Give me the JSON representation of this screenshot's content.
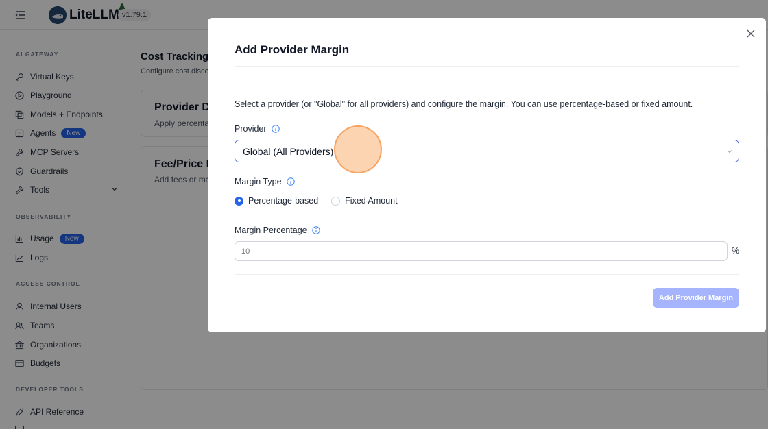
{
  "header": {
    "app_name": "LiteLLM",
    "version": "v1.79.1"
  },
  "sidebar": {
    "sections": [
      {
        "title": "AI GATEWAY"
      },
      {
        "title": "OBSERVABILITY"
      },
      {
        "title": "ACCESS CONTROL"
      },
      {
        "title": "DEVELOPER TOOLS"
      }
    ],
    "items": [
      {
        "label": "Virtual Keys",
        "icon": "key-icon"
      },
      {
        "label": "Playground",
        "icon": "play-icon"
      },
      {
        "label": "Models + Endpoints",
        "icon": "models-icon"
      },
      {
        "label": "Agents",
        "icon": "agent-icon",
        "badge": "New"
      },
      {
        "label": "MCP Servers",
        "icon": "tool-icon"
      },
      {
        "label": "Guardrails",
        "icon": "shield-icon"
      },
      {
        "label": "Tools",
        "icon": "wrench-icon"
      },
      {
        "label": "Usage",
        "icon": "bar-chart-icon",
        "badge": "New"
      },
      {
        "label": "Logs",
        "icon": "line-chart-icon"
      },
      {
        "label": "Internal Users",
        "icon": "user-icon"
      },
      {
        "label": "Teams",
        "icon": "team-icon"
      },
      {
        "label": "Organizations",
        "icon": "bank-icon"
      },
      {
        "label": "Budgets",
        "icon": "credit-card-icon"
      },
      {
        "label": "API Reference",
        "icon": "api-icon"
      }
    ]
  },
  "main": {
    "title": "Cost Tracking S",
    "subtitle": "Configure cost disco",
    "cards": [
      {
        "title": "Provider Di",
        "subtitle": "Apply percenta"
      },
      {
        "title": "Fee/Price M",
        "subtitle": "Add fees or ma"
      }
    ]
  },
  "modal": {
    "title": "Add Provider Margin",
    "description": "Select a provider (or \"Global\" for all providers) and configure the margin. You can use percentage-based or fixed amount.",
    "provider_label": "Provider",
    "provider_value": "Global (All Providers)",
    "margin_type_label": "Margin Type",
    "margin_type_options": [
      "Percentage-based",
      "Fixed Amount"
    ],
    "margin_type_selected": "Percentage-based",
    "margin_percentage_label": "Margin Percentage",
    "margin_percentage_placeholder": "10",
    "margin_percentage_suffix": "%",
    "submit_label": "Add Provider Margin"
  },
  "colors": {
    "accent": "#2563eb",
    "button_disabled": "#a5b4fc",
    "overlay": "rgba(0,0,0,0.45)",
    "click_marker": "#fbb073"
  }
}
